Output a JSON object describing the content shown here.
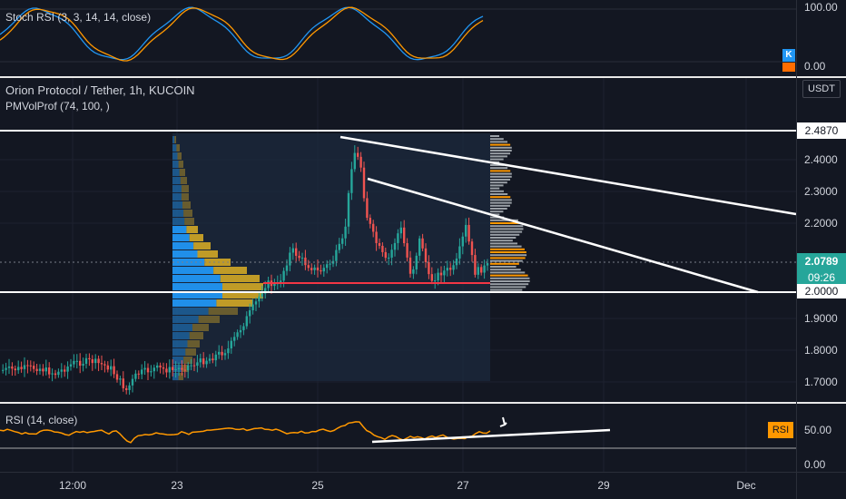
{
  "stoch": {
    "legend": "Stoch RSI (3, 3, 14, 14, close)",
    "axis": [
      "100.00",
      "0.00"
    ],
    "badge_k": "K"
  },
  "main": {
    "title": "Orion Protocol / Tether, 1h, KUCOIN",
    "indicator": "PMVolProf (74, 100, )",
    "currency": "USDT",
    "axis_labels": [
      "2.4000",
      "2.3000",
      "2.2000",
      "1.9000",
      "1.8000",
      "1.7000"
    ],
    "tags": {
      "resistance": "2.4870",
      "last_price": "2.0789",
      "countdown": "09:26",
      "support": "2.0000"
    }
  },
  "rsi": {
    "legend": "RSI (14, close)",
    "axis": [
      "50.00",
      "0.00"
    ],
    "badge": "RSI"
  },
  "time_axis": [
    "12:00",
    "23",
    "25",
    "27",
    "29",
    "Dec"
  ],
  "colors": {
    "bg": "#131722",
    "up": "#26a69a",
    "down": "#ef5350",
    "blue": "#2196f3",
    "orange": "#ff9800",
    "gold": "#c9a227"
  }
}
